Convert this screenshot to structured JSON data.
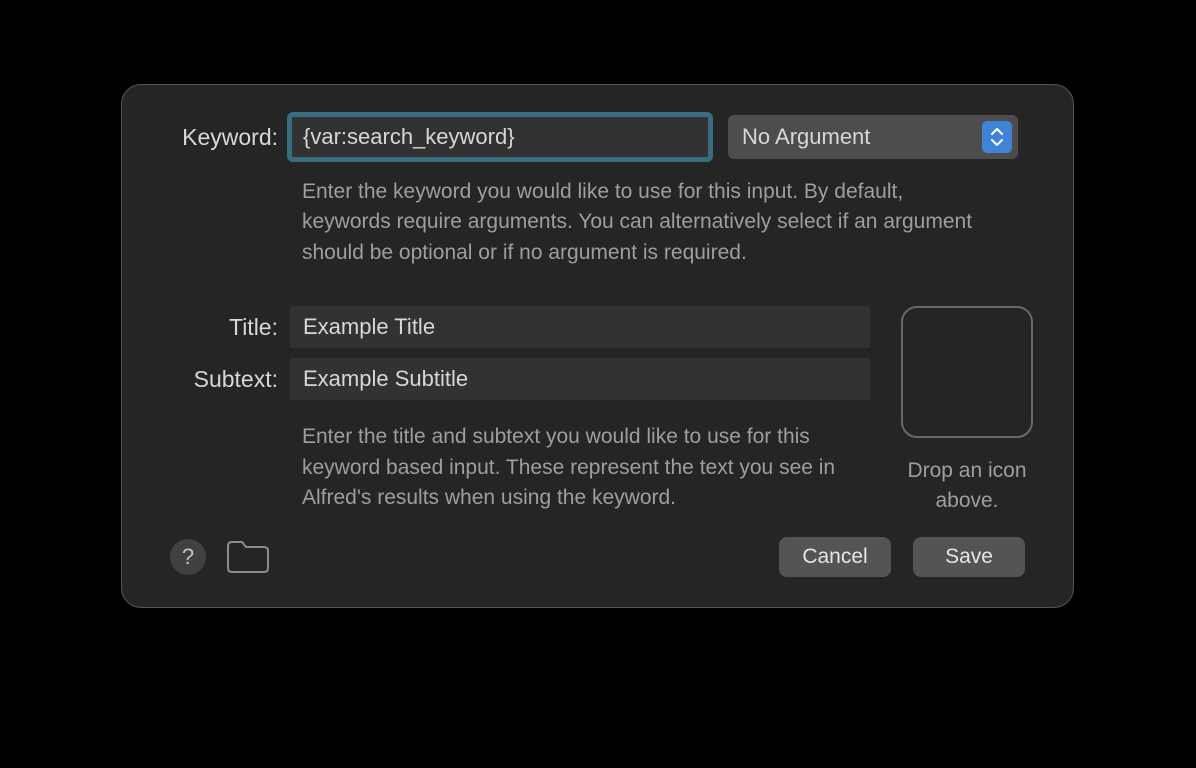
{
  "labels": {
    "keyword": "Keyword:",
    "title": "Title:",
    "subtext": "Subtext:"
  },
  "fields": {
    "keyword_value": "{var:search_keyword}",
    "title_value": "Example Title",
    "subtext_value": "Example Subtitle"
  },
  "argument_select": {
    "selected": "No Argument"
  },
  "help": {
    "keyword": "Enter the keyword you would like to use for this input. By default, keywords require arguments. You can alternatively select if an argument should be optional or if no argument is required.",
    "title_subtext": "Enter the title and subtext you would like to use for this keyword based input. These represent the text you see in Alfred's results when using the keyword.",
    "icon_drop": "Drop an icon above."
  },
  "buttons": {
    "cancel": "Cancel",
    "save": "Save"
  },
  "icons": {
    "help": "?"
  }
}
